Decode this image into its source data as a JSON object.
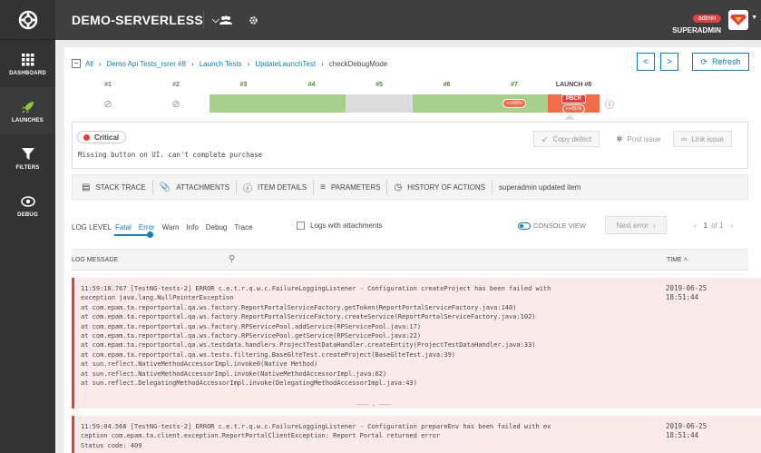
{
  "header": {
    "project": "DEMO-SERVERLESS",
    "user_role": "admin",
    "user_name": "SUPERADMIN"
  },
  "sidebar": {
    "items": [
      {
        "label": "DASHBOARD",
        "icon": "dashboard-grid-icon"
      },
      {
        "label": "LAUNCHES",
        "icon": "rocket-icon"
      },
      {
        "label": "FILTERS",
        "icon": "filter-icon"
      },
      {
        "label": "DEBUG",
        "icon": "eye-icon"
      }
    ]
  },
  "breadcrumbs": {
    "items": [
      "All",
      "Demo Api Tests_rsrer #8",
      "Launch Tests",
      "UpdateLaunchTest"
    ],
    "current": "checkDebugMode"
  },
  "toolbar": {
    "prev": "<",
    "next": ">",
    "refresh": "Refresh"
  },
  "retries": {
    "items": [
      {
        "label": "#1",
        "status": "skipped"
      },
      {
        "label": "#2",
        "status": "skipped"
      },
      {
        "label": "#3",
        "status": "passed"
      },
      {
        "label": "#4",
        "status": "passed"
      },
      {
        "label": "#5",
        "status": "interrupted"
      },
      {
        "label": "#6",
        "status": "passed"
      },
      {
        "label": "#7",
        "status": "failed",
        "chip": "<+89%"
      },
      {
        "label": "LAUNCH #8",
        "status": "failed-current",
        "defect": "PBCR",
        "chip": "<+81%"
      }
    ]
  },
  "defect": {
    "severity": "Critical",
    "message": "Missing button on UI. can't complete purchase",
    "actions": {
      "copy": "Copy defect",
      "post": "Post issue",
      "link": "Link issue"
    }
  },
  "tabs": {
    "stack": "STACK TRACE",
    "attachments": "ATTACHMENTS",
    "details": "ITEM DETAILS",
    "params": "PARAMETERS",
    "history": "HISTORY OF ACTIONS",
    "activity": "superadmin updated item"
  },
  "log_level": {
    "label": "LOG LEVEL",
    "levels": [
      "Fatal",
      "Error",
      "Warn",
      "Info",
      "Debug",
      "Trace"
    ],
    "attachments_checkbox": "Logs with attachments",
    "console_view": "CONSOLE VIEW",
    "next_error": "Next error",
    "page": "1",
    "of": "of 1"
  },
  "log_table": {
    "col_message": "LOG MESSAGE",
    "col_time": "TIME",
    "rows": [
      {
        "message": "11:59:18.767 [TestNG-tests-2] ERROR c.e.t.r.q.w.c.FailureLoggingListener - Configuration createProject has been failed with\nexception java.lang.NullPointerException\nat com.epam.ta.reportportal.qa.ws.factory.ReportPortalServiceFactory.getToken(ReportPortalServiceFactory.java:140)\nat com.epam.ta.reportportal.qa.ws.factory.ReportPortalServiceFactory.createService(ReportPortalServiceFactory.java:102)\nat com.epam.ta.reportportal.qa.ws.factory.RPServicePool.addService(RPServicePool.java:17)\nat com.epam.ta.reportportal.qa.ws.factory.RPServicePool.getService(RPServicePool.java:22)\nat com.epam.ta.reportportal.qa.ws.testdata.handlers.ProjectTestDataHandler.createEntity(ProjectTestDataHandler.java:33)\nat com.epam.ta.reportportal.qa.ws.tests.filtering.BaseGlteTest.createProject(BaseGlteTest.java:39)\nat sun.reflect.NativeMethodAccessorImpl.invoke0(Native Method)\nat sun.reflect.NativeMethodAccessorImpl.invoke(NativeMethodAccessorImpl.java:62)\nat sun.reflect.DelegatingMethodAccessorImpl.invoke(DelegatingMethodAccessorImpl.java:43)",
        "time": "2019-06-25\n18:51:44"
      },
      {
        "message": "11:59:04.568 [TestNG-tests-2] ERROR c.e.t.r.q.w.c.FailureLoggingListener - Configuration prepareEnv has been failed with ex\nception com.epam.ta.client.exception.ReportPortalClientException: Report Portal returned error\nStatus code: 409",
        "time": "2019-06-25\n18:51:44"
      }
    ]
  },
  "colors": {
    "accent": "#0f7fbf",
    "passed": "#a7d08c",
    "failed": "#f36c4a",
    "skipped": "#ffffff",
    "interrupted": "#dcdcdc",
    "sidebar": "#333333",
    "header": "#3f3f3f",
    "error_row": "#fbeaea"
  }
}
